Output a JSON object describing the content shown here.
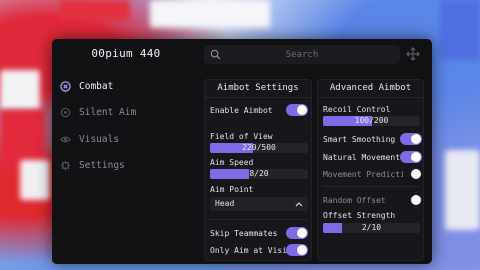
{
  "app": {
    "title": "00pium 440"
  },
  "search": {
    "placeholder": "Search"
  },
  "sidebar": {
    "items": [
      {
        "label": "Combat",
        "icon": "combat-icon",
        "active": true
      },
      {
        "label": "Silent Aim",
        "icon": "target-icon",
        "active": false
      },
      {
        "label": "Visuals",
        "icon": "eye-icon",
        "active": false
      },
      {
        "label": "Settings",
        "icon": "gear-icon",
        "active": false
      }
    ]
  },
  "aimbot": {
    "title": "Aimbot Settings",
    "enable_label": "Enable Aimbot",
    "enable_on": true,
    "fov_label": "Field of View",
    "fov_value_text": "220/500",
    "fov_fraction": 0.44,
    "speed_label": "Aim Speed",
    "speed_value_text": "8/20",
    "speed_fraction": 0.4,
    "point_label": "Aim Point",
    "point_value": "Head",
    "skip_label": "Skip Teammates",
    "skip_on": true,
    "visible_label": "Only Aim at Visib",
    "visible_on": true
  },
  "advanced": {
    "title": "Advanced Aimbot",
    "recoil_label": "Recoil Control",
    "recoil_value_text": "100/200",
    "recoil_fraction": 0.5,
    "smart_label": "Smart Smoothing",
    "smart_on": true,
    "natural_label": "Natural Movement",
    "natural_on": true,
    "prediction_label": "Movement Predicti",
    "prediction_on": false,
    "random_label": "Random Offset",
    "random_on": false,
    "offset_label": "Offset Strength",
    "offset_value_text": "2/10",
    "offset_fraction": 0.2
  },
  "colors": {
    "accent": "#7e6ce6",
    "window": "#111114",
    "panel": "#17171b"
  }
}
